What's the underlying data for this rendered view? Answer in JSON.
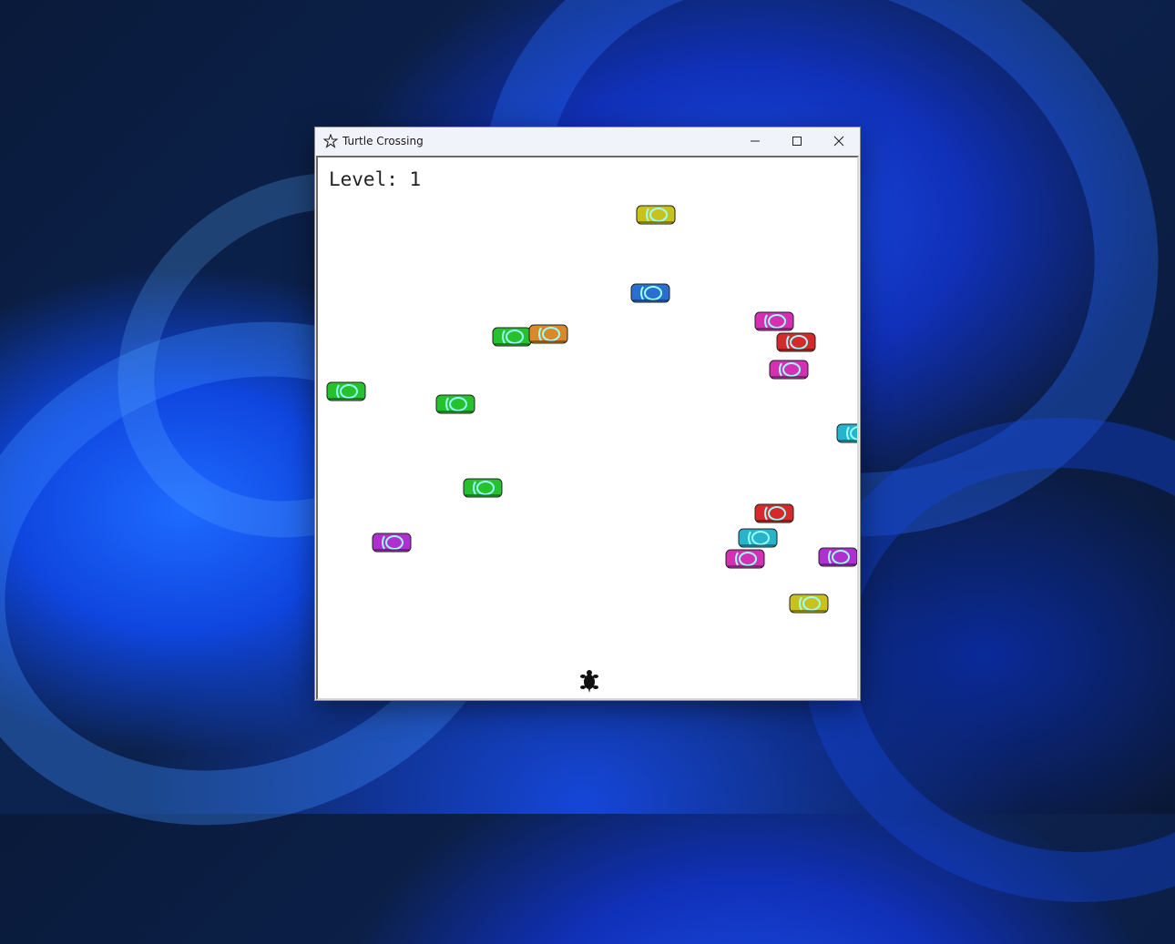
{
  "window": {
    "title": "Turtle Crossing",
    "controls": {
      "minimize_icon": "minimize-icon",
      "maximize_icon": "maximize-icon",
      "close_icon": "close-icon"
    }
  },
  "game": {
    "level_label": "Level: 1",
    "player_icon": "turtle-icon",
    "car_colors": {
      "yellow": "#c9c21a",
      "blue": "#2a6fd0",
      "magenta": "#d62fb4",
      "red": "#d62a2a",
      "green": "#26c22e",
      "orange": "#d9892a",
      "cyan": "#27b3c9",
      "purple": "#b02fd0"
    },
    "cars": [
      {
        "color": "yellow"
      },
      {
        "color": "blue"
      },
      {
        "color": "magenta"
      },
      {
        "color": "red"
      },
      {
        "color": "magenta"
      },
      {
        "color": "green"
      },
      {
        "color": "orange"
      },
      {
        "color": "green"
      },
      {
        "color": "green"
      },
      {
        "color": "cyan"
      },
      {
        "color": "green"
      },
      {
        "color": "red"
      },
      {
        "color": "cyan"
      },
      {
        "color": "purple"
      },
      {
        "color": "magenta"
      },
      {
        "color": "purple"
      },
      {
        "color": "yellow"
      }
    ]
  }
}
